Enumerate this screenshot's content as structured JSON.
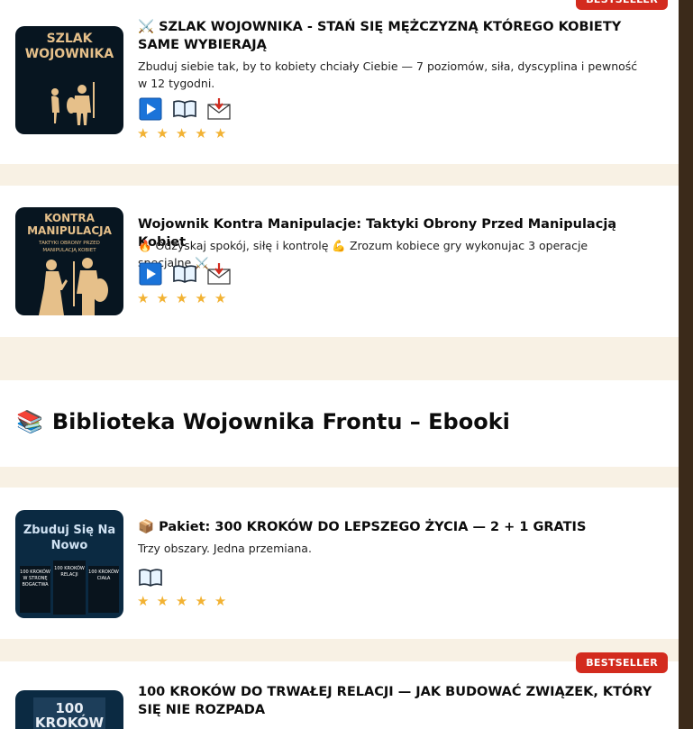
{
  "products": [
    {
      "title": "⚔️ SZLAK WOJOWNIKA - STAŃ SIĘ MĘŻCZYZNĄ KTÓREGO KOBIETY SAME WYBIERAJĄ",
      "description": "Zbuduj siebie tak, by to kobiety chciały Ciebie — 7 poziomów, siła, dyscyplina i pewność w 12 tygodni.",
      "cover_title": "SZLAK WOJOWNIKA",
      "rating": 5,
      "badge": "BESTSELLER"
    },
    {
      "title": "Wojownik Kontra Manipulacje: Taktyki Obrony Przed Manipulacją Kobiet",
      "description": "🔥 Odzyskaj spokój, siłę i kontrolę 💪 Zrozum kobiece gry wykonujac 3 operacje specjalne ⚔️",
      "cover_title_1": "KONTRA",
      "cover_title_2": "MANIPULACJA",
      "cover_subtitle_1": "TAKTYKI OBRONY PRZED",
      "cover_subtitle_2": "MANIPULACJĄ KOBIET",
      "rating": 5
    },
    {
      "title": "📦 Pakiet: 300 KROKÓW DO LEPSZEGO ŻYCIA — 2 + 1 GRATIS",
      "description": "Trzy obszary. Jedna przemiana.",
      "cover_title_1": "Zbuduj Się Na",
      "cover_title_2": "Nowo",
      "cover_book_1": "100 KROKÓW",
      "cover_book_2": "100 KROKÓW",
      "cover_book_3": "100 KROKÓW",
      "cover_book_1b": "W STRONĘ BOGACTWA",
      "cover_book_2b": "RELACJI",
      "cover_book_3b": "CIAŁA",
      "rating": 5
    },
    {
      "title": "100 KROKÓW DO TRWAŁEJ RELACJI — JAK BUDOWAĆ ZWIĄZEK, KTÓRY SIĘ NIE ROZPADA",
      "cover_title_1": "100",
      "cover_title_2": "KROKÓW",
      "badge": "BESTSELLER"
    }
  ],
  "section": {
    "icon": "📚",
    "title": "Biblioteka Wojownika Frontu – Ebooki"
  },
  "icon_names": [
    "play-icon",
    "book-icon",
    "envelope-icon"
  ],
  "colors": {
    "accent_red": "#d32b1e",
    "star": "#f2b233",
    "page_bg": "#f8f1e4",
    "card_bg": "#ffffff",
    "play_blue": "#1a73d9",
    "cover_dark": "#0b1a24",
    "cover_gold": "#e6c08a"
  }
}
